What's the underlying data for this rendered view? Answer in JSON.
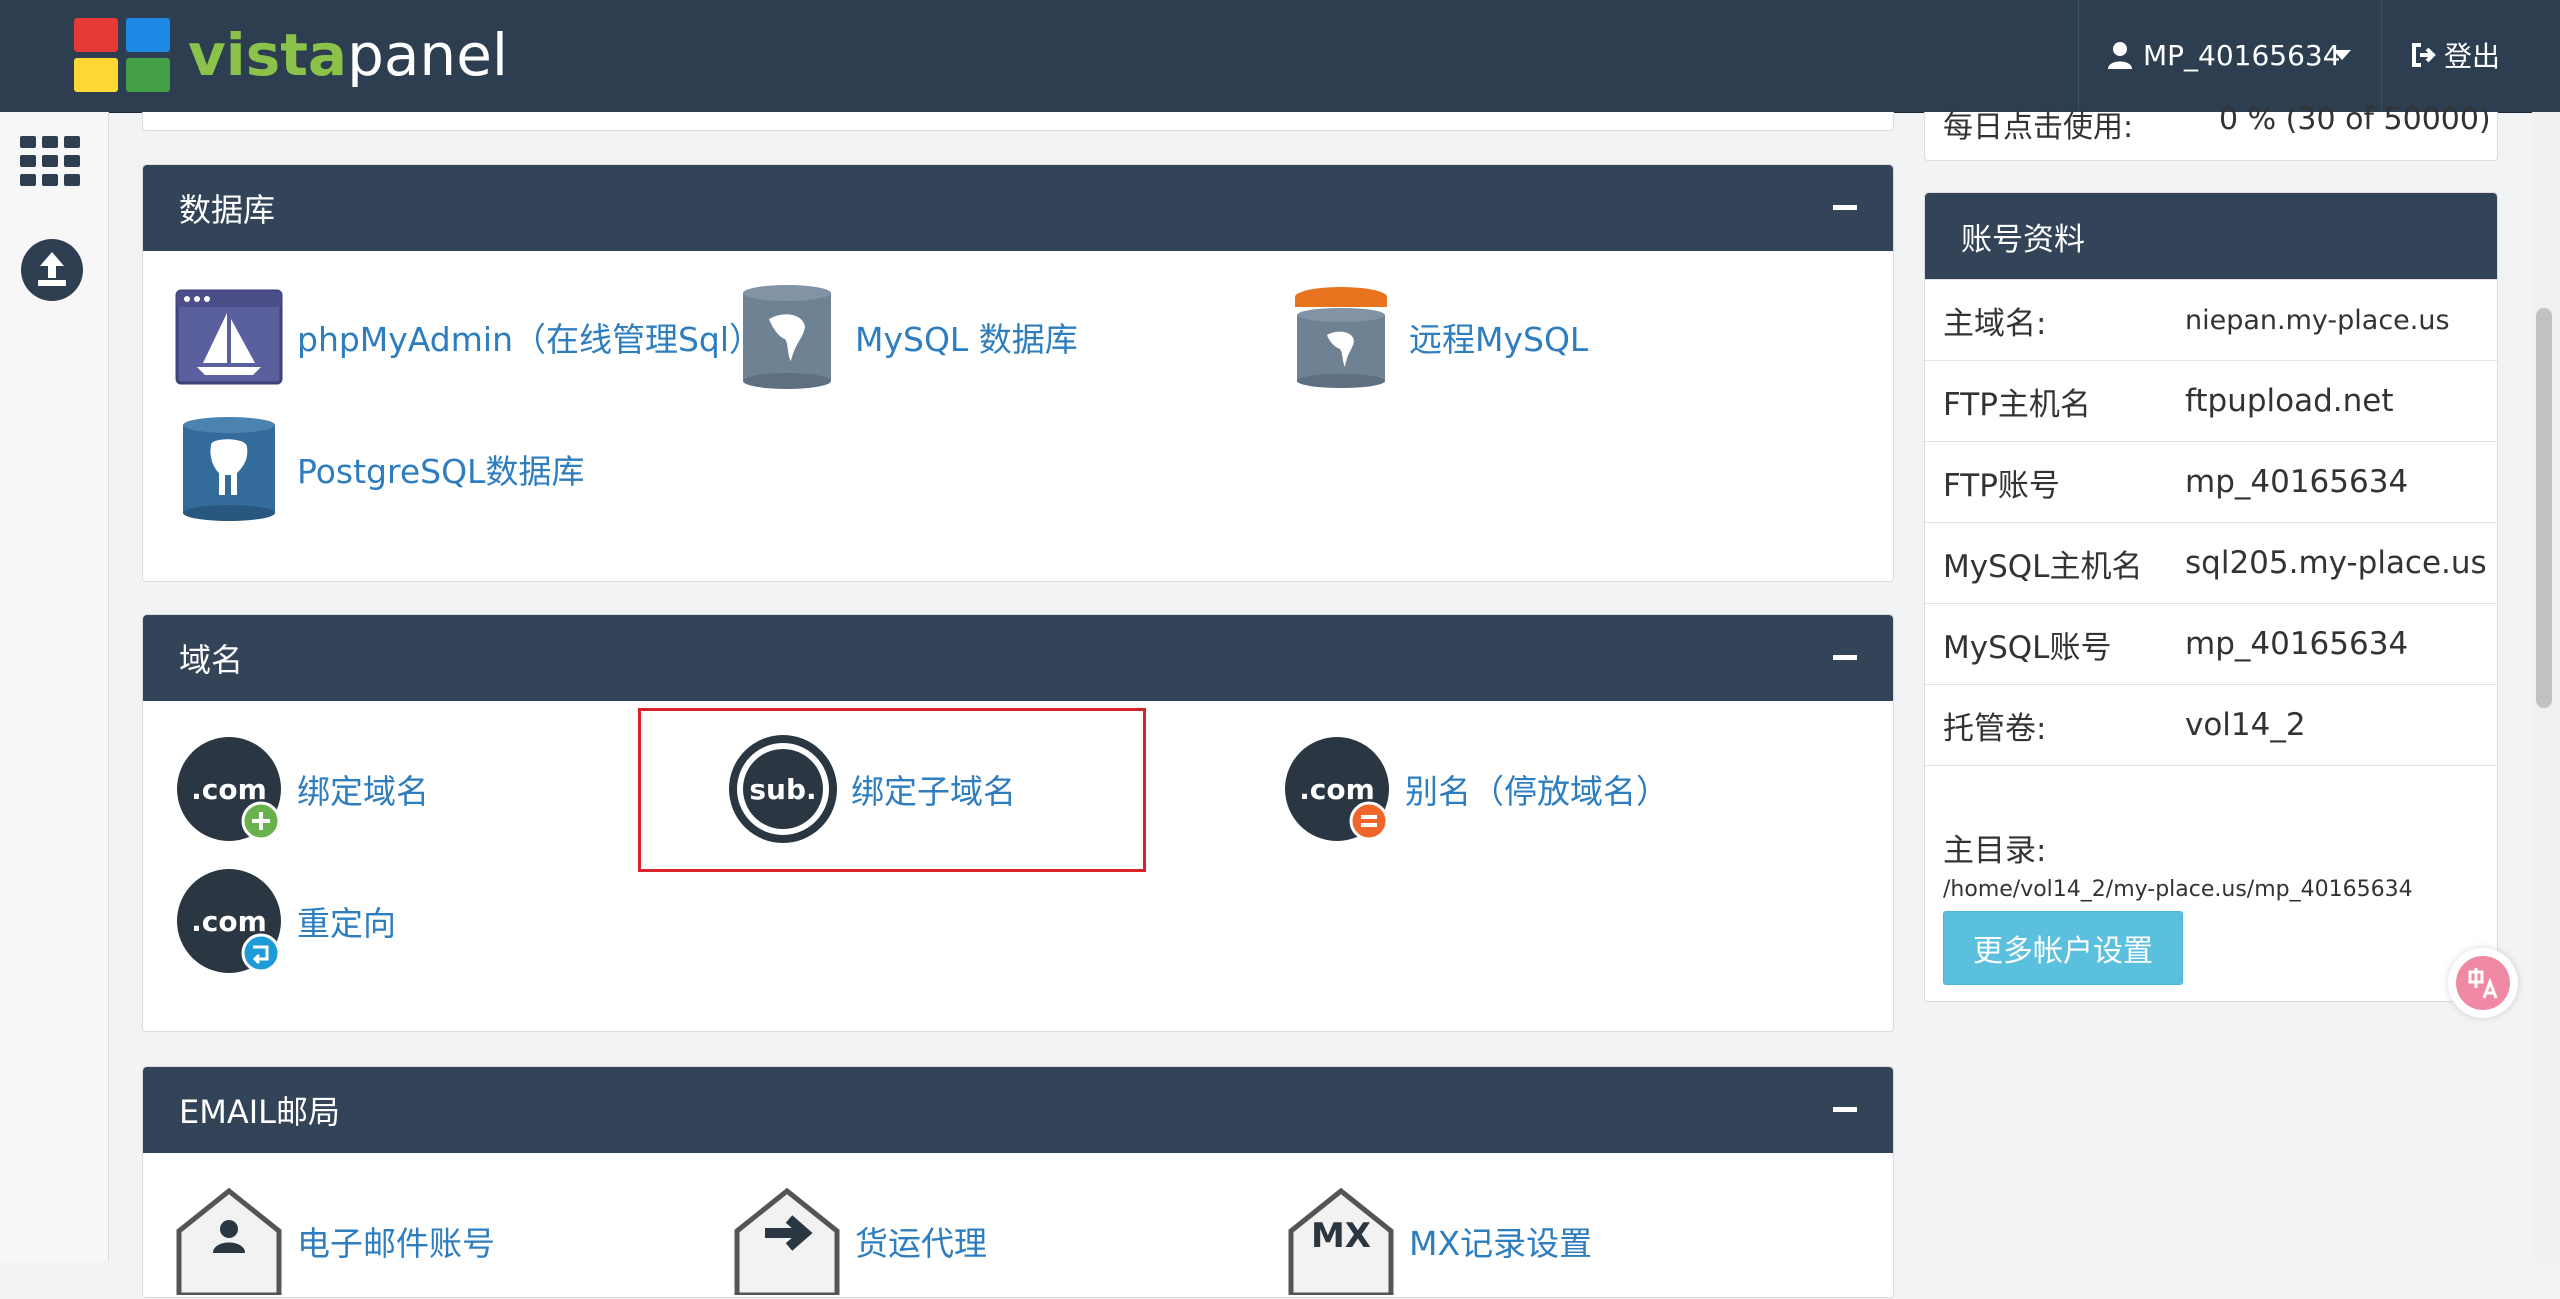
{
  "topbar": {
    "logo_part1": "vista",
    "logo_part2": "panel",
    "username": "MP_40165634",
    "logout_label": "登出"
  },
  "stats": {
    "daily_hits_label": "每日点击使用:",
    "daily_hits_value": "0 % (30 of 50000)"
  },
  "databases": {
    "title": "数据库",
    "items": [
      {
        "label": "phpMyAdmin（在线管理Sql）"
      },
      {
        "label": "MySQL 数据库"
      },
      {
        "label": "远程MySQL"
      },
      {
        "label": "PostgreSQL数据库"
      }
    ]
  },
  "domains": {
    "title": "域名",
    "items": [
      {
        "label": "绑定域名",
        "icon_text": ".com"
      },
      {
        "label": "绑定子域名",
        "icon_text": "sub."
      },
      {
        "label": "别名（停放域名）",
        "icon_text": ".com"
      },
      {
        "label": "重定向",
        "icon_text": ".com"
      }
    ]
  },
  "email": {
    "title": "EMAIL邮局",
    "items": [
      {
        "label": "电子邮件账号"
      },
      {
        "label": "货运代理"
      },
      {
        "label": "MX记录设置",
        "icon_text": "MX"
      }
    ]
  },
  "account": {
    "title": "账号资料",
    "rows": [
      {
        "key": "主域名:",
        "value": "niepan.my-place.us"
      },
      {
        "key": "FTP主机名",
        "value": "ftpupload.net"
      },
      {
        "key": "FTP账号",
        "value": "mp_40165634"
      },
      {
        "key": "MySQL主机名",
        "value": "sql205.my-place.us"
      },
      {
        "key": "MySQL账号",
        "value": "mp_40165634"
      },
      {
        "key": "托管卷:",
        "value": "vol14_2"
      }
    ],
    "home_label": "主目录:",
    "home_value": "/home/vol14_2/my-place.us/mp_40165634",
    "more_button": "更多帐户设置"
  },
  "colors": {
    "header_bg": "#2c3e50",
    "panel_head": "#344458",
    "link": "#2e7dbf",
    "button": "#5bc0de",
    "highlight": "#d9232b"
  }
}
